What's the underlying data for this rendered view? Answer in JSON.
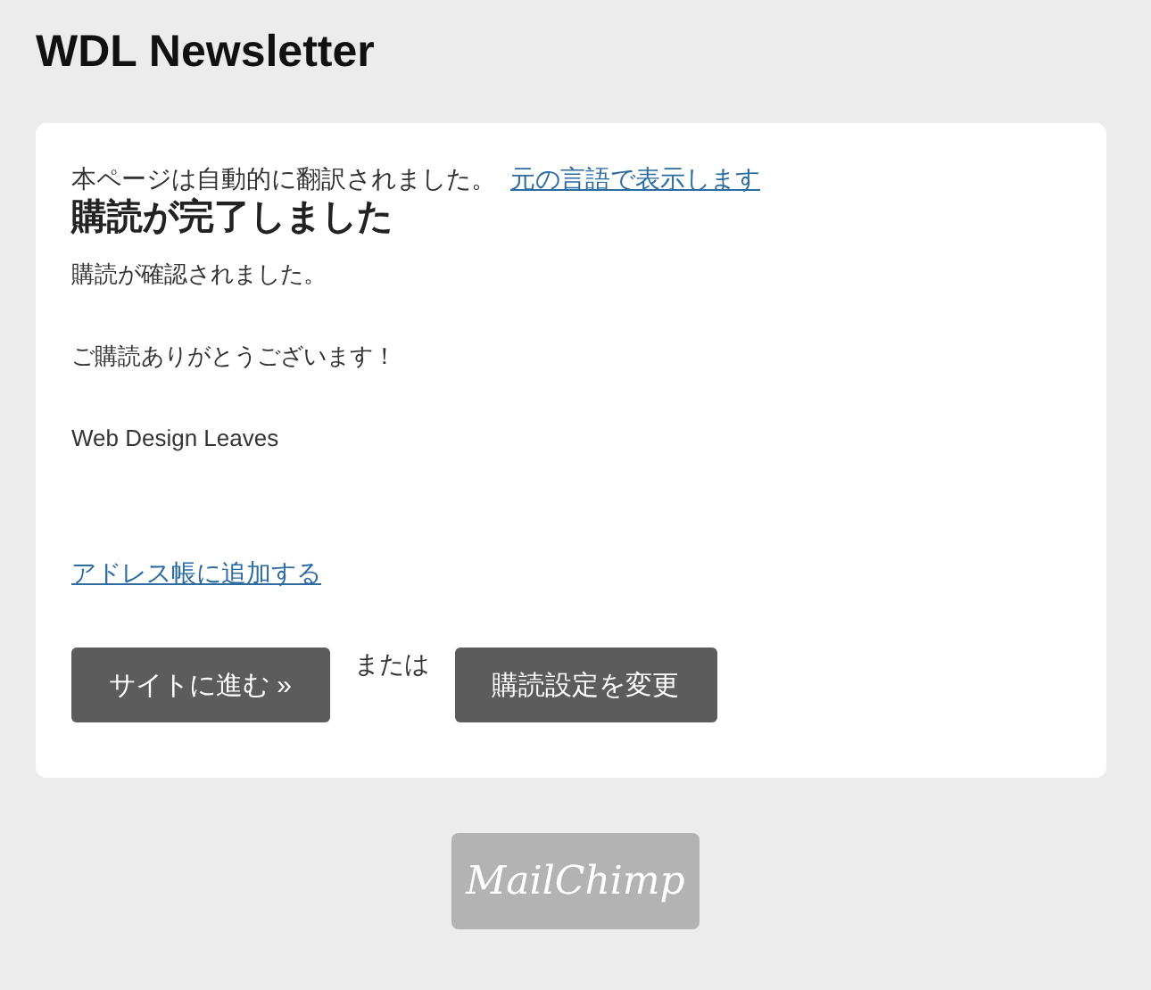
{
  "header": {
    "title": "WDL Newsletter"
  },
  "card": {
    "notice": {
      "text": "本ページは自動的に翻訳されました。",
      "link": "元の言語で表示します"
    },
    "heading": "購読が完了しました",
    "paragraphs": [
      "購読が確認されました。",
      "ご購読ありがとうございます！",
      "Web Design Leaves"
    ],
    "address_link": "アドレス帳に追加する",
    "actions": [
      {
        "kind": "button",
        "label": "サイトに進む »"
      },
      {
        "kind": "text",
        "label": "または"
      },
      {
        "kind": "button",
        "label": "購読設定を変更"
      }
    ]
  },
  "footer": {
    "logo": "MailChimp"
  }
}
